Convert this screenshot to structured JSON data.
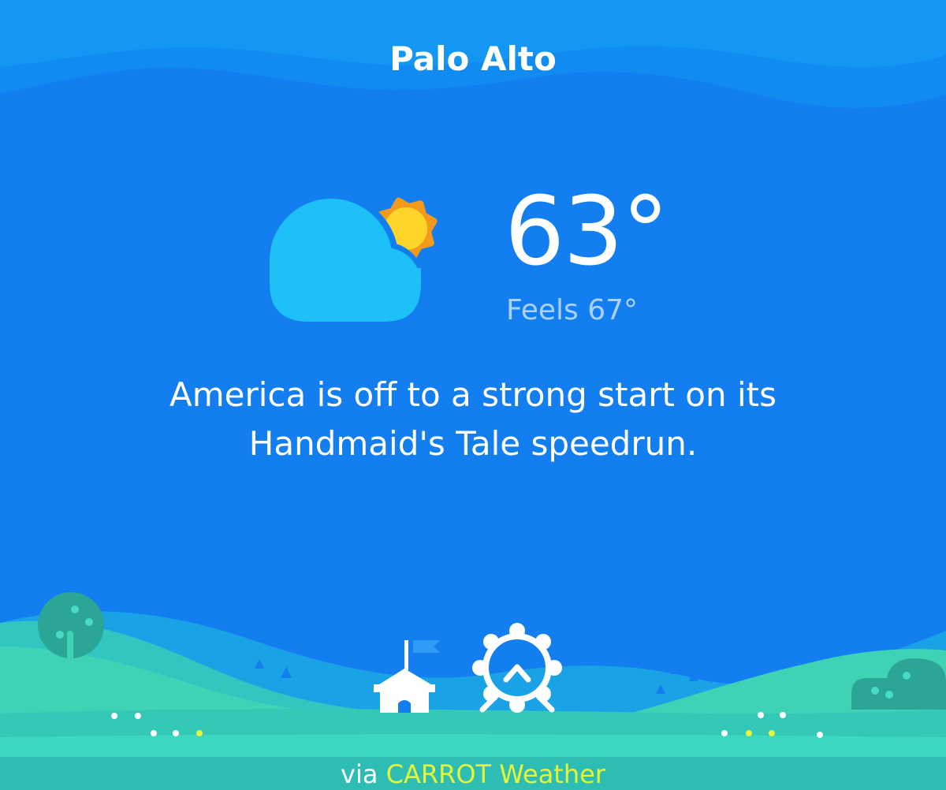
{
  "location": {
    "city": "Palo Alto"
  },
  "current": {
    "temperature": "63°",
    "feels_like": "Feels 67°",
    "condition_icon": "partly-cloudy-icon"
  },
  "message": "America is off to a strong start on its Handmaid's Tale speedrun.",
  "footer": {
    "prefix": "via ",
    "brand": "CARROT Weather"
  },
  "colors": {
    "sky": "#127ef0",
    "sky_band": "#0f8df2",
    "cloud": "#1ec0f8",
    "sun_outer": "#f39a1a",
    "sun_inner": "#ffd52a",
    "hill_far": "#1aa2e6",
    "hill_near": "#3fd3b6",
    "ground": "#2bc0b4",
    "brand": "#e6f53a"
  }
}
